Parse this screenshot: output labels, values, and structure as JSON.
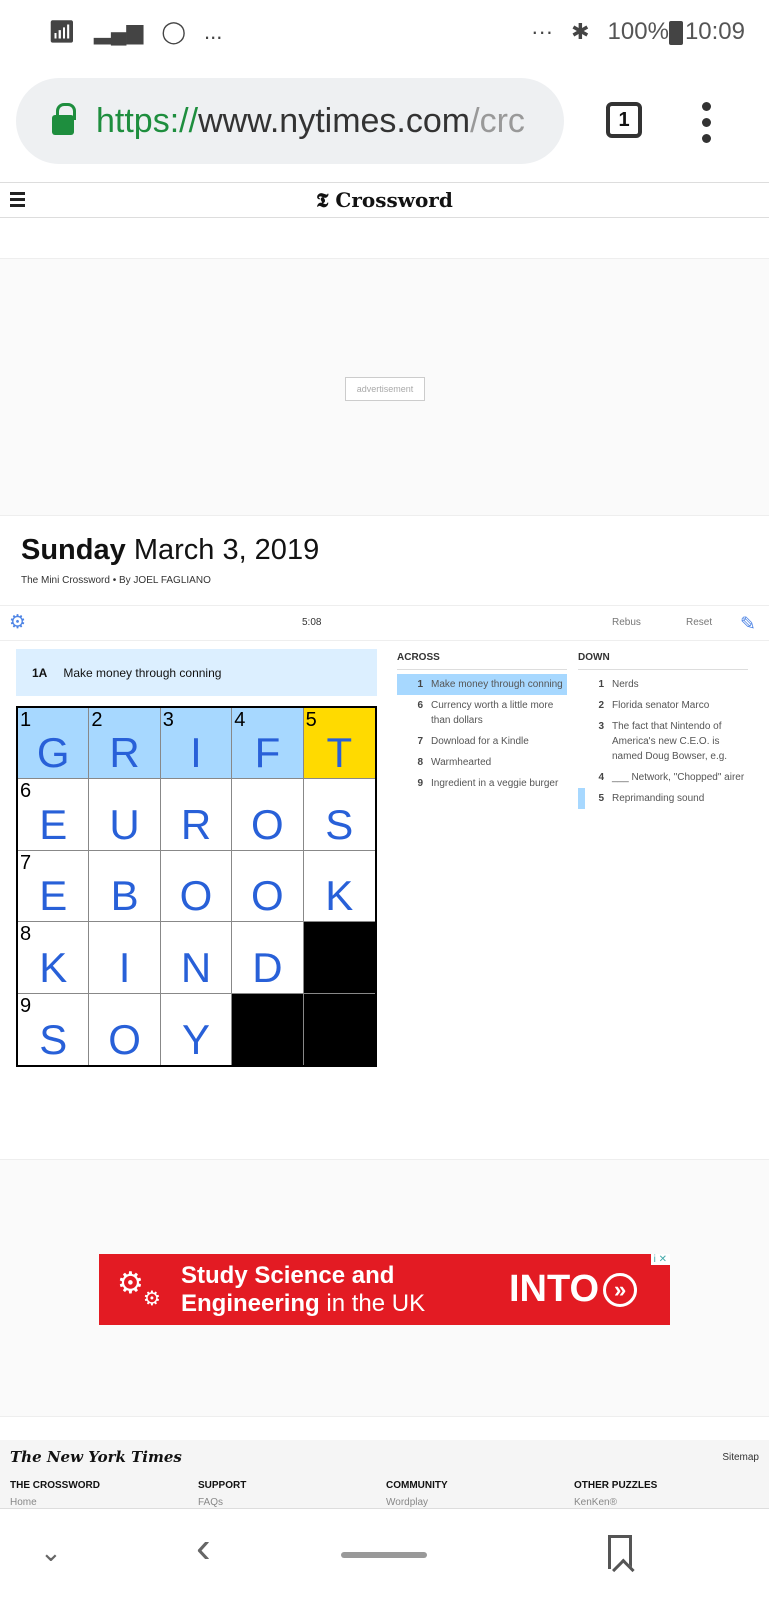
{
  "status_bar": {
    "time": "10:09",
    "battery": "100%",
    "more_left": "...",
    "more_right": "···",
    "icons": [
      "wifi-icon",
      "signal-icon",
      "whatsapp-icon",
      "bluetooth-icon",
      "battery-icon"
    ]
  },
  "browser": {
    "url_scheme": "https://",
    "url_host": "www.nytimes.com",
    "url_path": "/crc",
    "tab_count": "1"
  },
  "site": {
    "title": "Crossword"
  },
  "ad_top": {
    "label": "advertisement"
  },
  "puzzle": {
    "day": "Sunday",
    "date": "March 3, 2019",
    "byline": "The Mini Crossword  •  By JOEL FAGLIANO",
    "timer": "5:08",
    "rebus_label": "Rebus",
    "reset_label": "Reset",
    "current_clue_number": "1A",
    "current_clue_text": "Make money through conning",
    "grid": [
      [
        {
          "num": "1",
          "letter": "G",
          "state": "hl"
        },
        {
          "num": "2",
          "letter": "R",
          "state": "hl"
        },
        {
          "num": "3",
          "letter": "I",
          "state": "hl"
        },
        {
          "num": "4",
          "letter": "F",
          "state": "hl"
        },
        {
          "num": "5",
          "letter": "T",
          "state": "cur"
        }
      ],
      [
        {
          "num": "6",
          "letter": "E"
        },
        {
          "letter": "U"
        },
        {
          "letter": "R"
        },
        {
          "letter": "O"
        },
        {
          "letter": "S"
        }
      ],
      [
        {
          "num": "7",
          "letter": "E"
        },
        {
          "letter": "B"
        },
        {
          "letter": "O"
        },
        {
          "letter": "O"
        },
        {
          "letter": "K"
        }
      ],
      [
        {
          "num": "8",
          "letter": "K"
        },
        {
          "letter": "I"
        },
        {
          "letter": "N"
        },
        {
          "letter": "D"
        },
        {
          "state": "blk"
        }
      ],
      [
        {
          "num": "9",
          "letter": "S"
        },
        {
          "letter": "O"
        },
        {
          "letter": "Y"
        },
        {
          "state": "blk"
        },
        {
          "state": "blk"
        }
      ]
    ],
    "across_title": "ACROSS",
    "down_title": "DOWN",
    "across": [
      {
        "n": "1",
        "text": "Make money through conning",
        "state": "sel"
      },
      {
        "n": "6",
        "text": "Currency worth a little more than dollars"
      },
      {
        "n": "7",
        "text": "Download for a Kindle"
      },
      {
        "n": "8",
        "text": "Warmhearted"
      },
      {
        "n": "9",
        "text": "Ingredient in a veggie burger"
      }
    ],
    "down": [
      {
        "n": "1",
        "text": "Nerds"
      },
      {
        "n": "2",
        "text": "Florida senator Marco"
      },
      {
        "n": "3",
        "text": "The fact that Nintendo of America's new C.E.O. is named Doug Bowser, e.g."
      },
      {
        "n": "4",
        "text": "___ Network, \"Chopped\" airer"
      },
      {
        "n": "5",
        "text": "Reprimanding sound",
        "state": "rel"
      }
    ]
  },
  "ad_bottom": {
    "line1": "Study Science and",
    "line2_bold": "Engineering",
    "line2_rest": " in the UK",
    "brand": "INTO",
    "brand_icon": "»",
    "adchoices": "i ✕"
  },
  "footer": {
    "logo": "The New York Times",
    "sitemap": "Sitemap",
    "columns": [
      {
        "title": "THE CROSSWORD",
        "first": "Home"
      },
      {
        "title": "SUPPORT",
        "first": "FAQs"
      },
      {
        "title": "COMMUNITY",
        "first": "Wordplay"
      },
      {
        "title": "OTHER PUZZLES",
        "first": "KenKen®"
      }
    ]
  },
  "colors": {
    "selected_word": "#a7d8ff",
    "current_cell": "#ffda00",
    "letter": "#2860d8",
    "clue_bar": "#dcefff",
    "accent": "#4f85e5",
    "ad_red": "#e31b23",
    "secure_green": "#1e8e3e"
  }
}
